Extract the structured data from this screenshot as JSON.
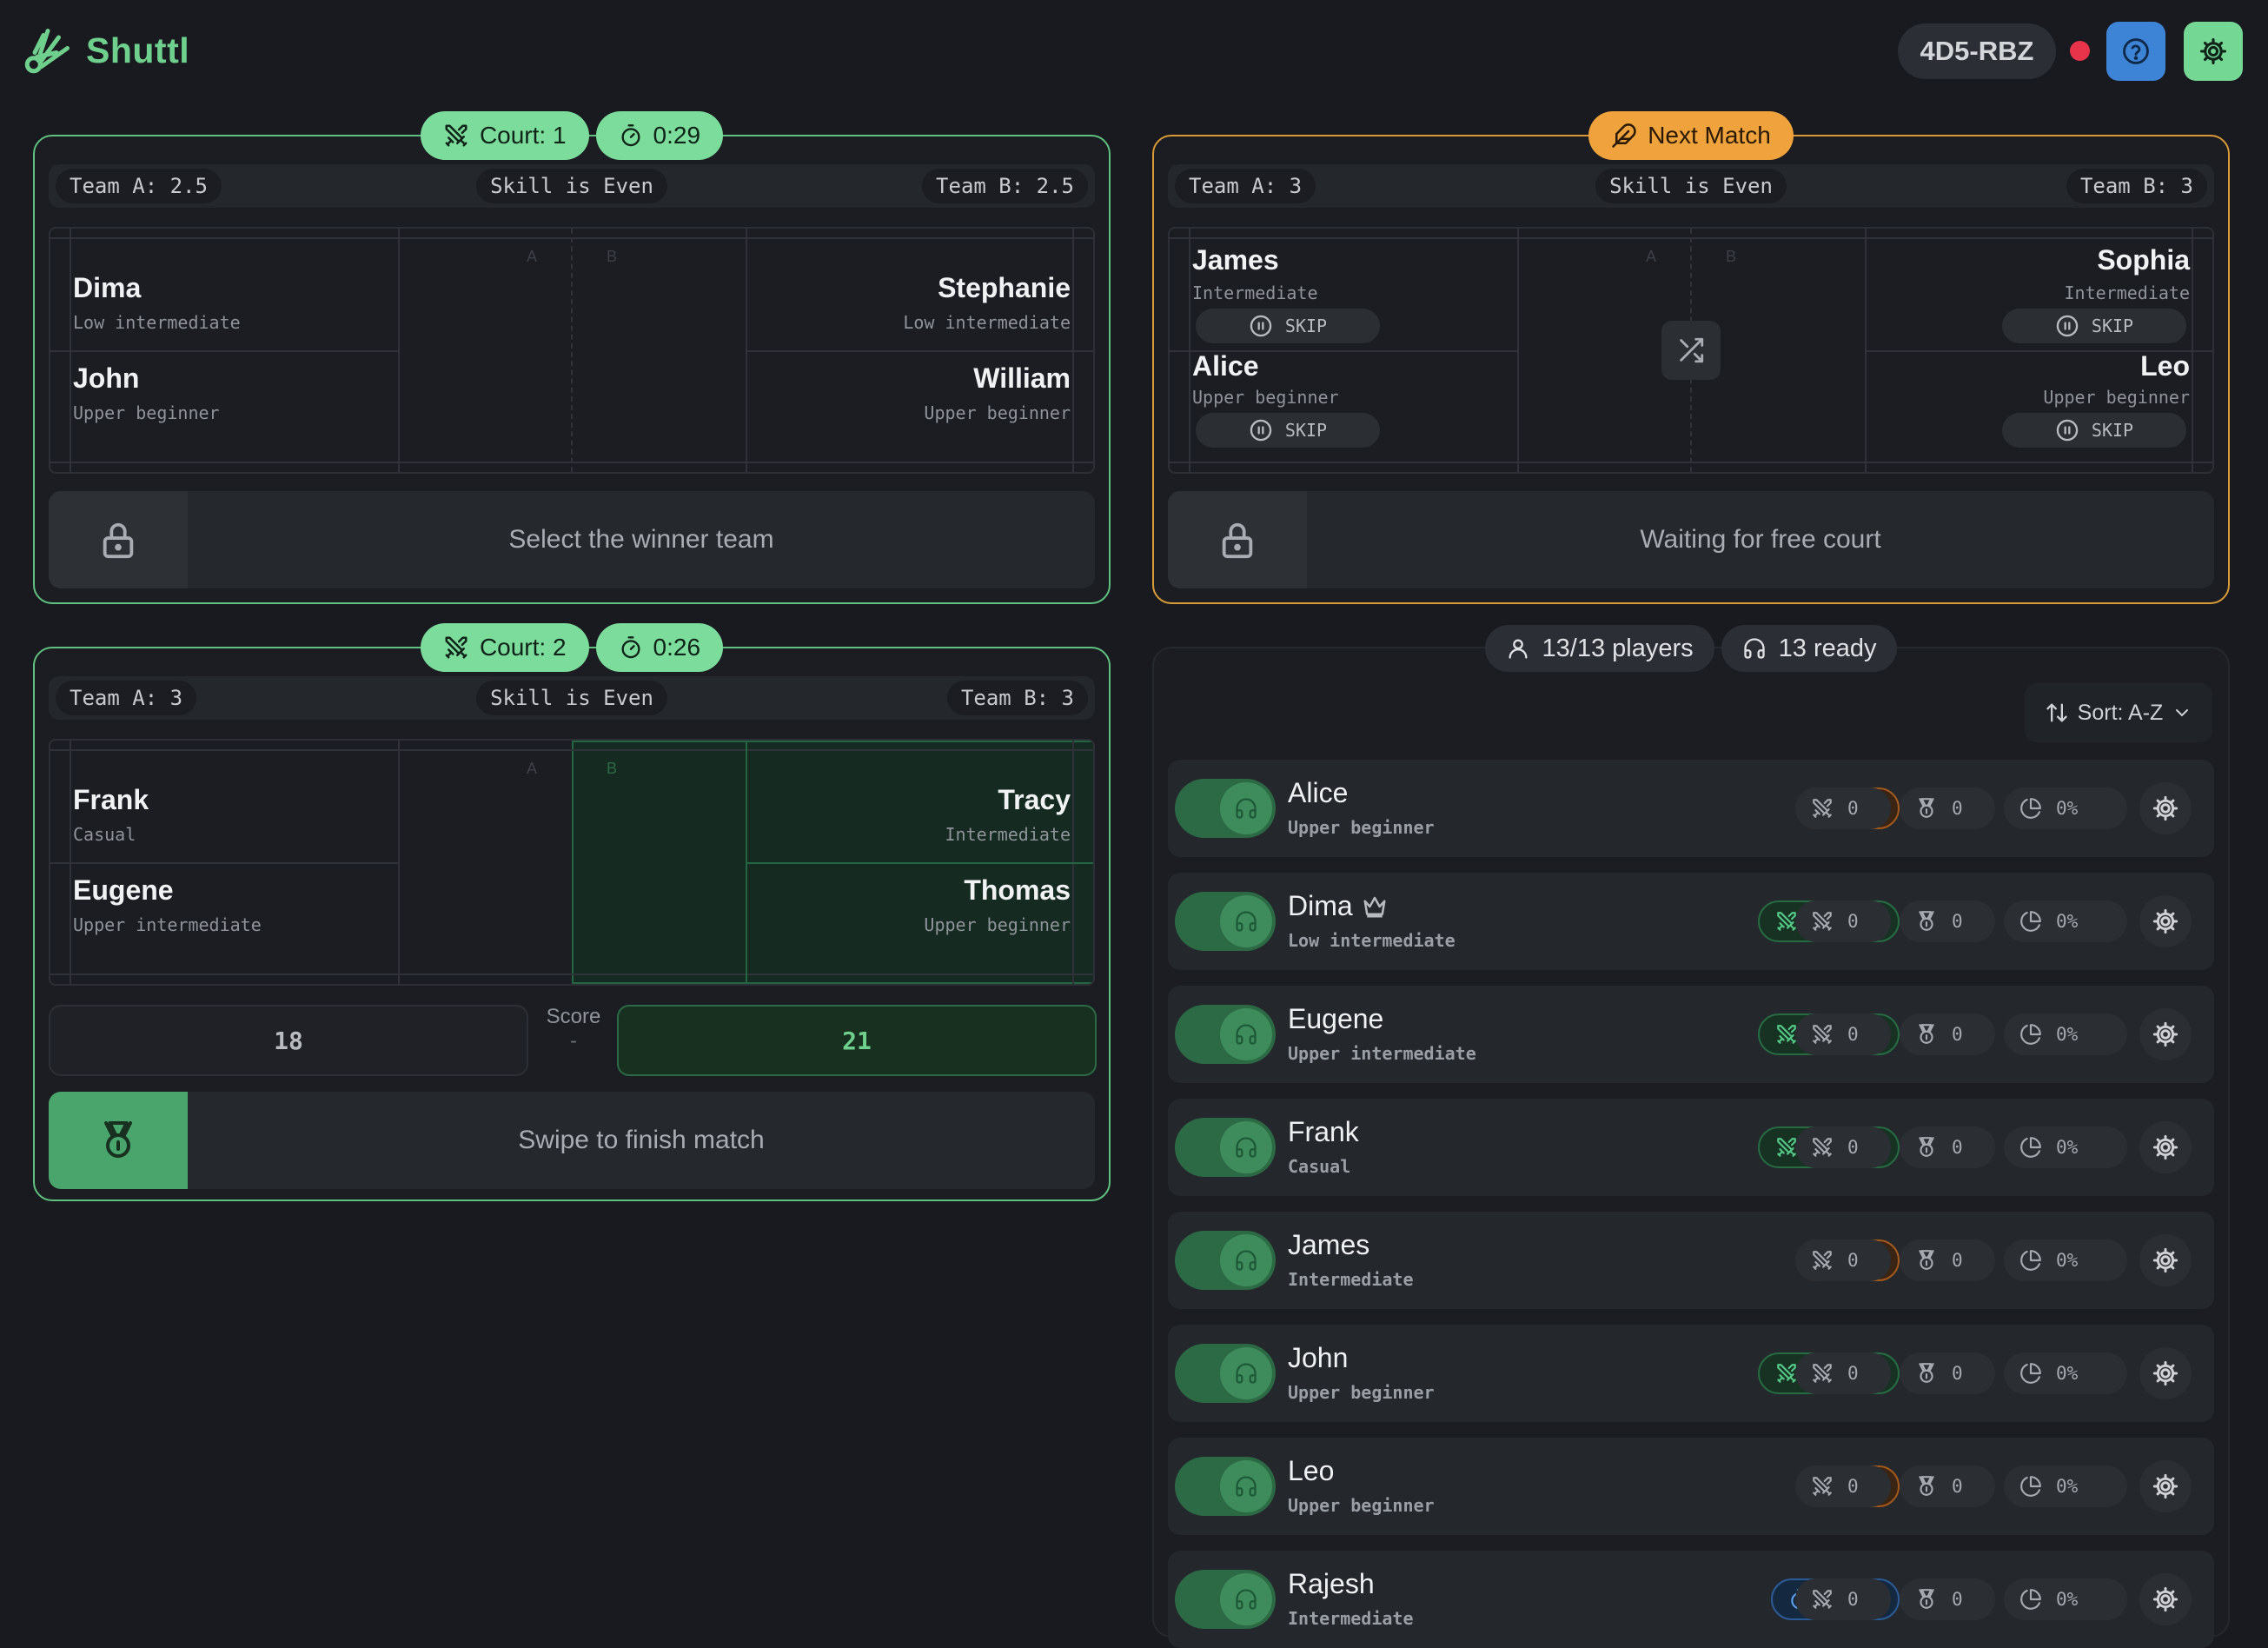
{
  "app": {
    "name": "Shuttl",
    "session_code": "4D5-RBZ"
  },
  "colors": {
    "accent": "#6fd08d",
    "next": "#f0a33d",
    "waiting": "#3d84d6",
    "record": "#e8344b"
  },
  "court1": {
    "court_label": "Court: 1",
    "timer": "0:29",
    "team_a": "Team A: 2.5",
    "skill": "Skill is Even",
    "team_b": "Team B: 2.5",
    "side_a": "A",
    "side_b": "B",
    "players_a": [
      {
        "name": "Dima",
        "level": "Low intermediate"
      },
      {
        "name": "John",
        "level": "Upper beginner"
      }
    ],
    "players_b": [
      {
        "name": "Stephanie",
        "level": "Low intermediate"
      },
      {
        "name": "William",
        "level": "Upper beginner"
      }
    ],
    "action": "Select the winner team"
  },
  "next_match": {
    "label": "Next Match",
    "team_a": "Team A: 3",
    "skill": "Skill is Even",
    "team_b": "Team B: 3",
    "side_a": "A",
    "side_b": "B",
    "players_a": [
      {
        "name": "James",
        "level": "Intermediate",
        "skip": "SKIP"
      },
      {
        "name": "Alice",
        "level": "Upper beginner",
        "skip": "SKIP"
      }
    ],
    "players_b": [
      {
        "name": "Sophia",
        "level": "Intermediate",
        "skip": "SKIP"
      },
      {
        "name": "Leo",
        "level": "Upper beginner",
        "skip": "SKIP"
      }
    ],
    "action": "Waiting for free court"
  },
  "court2": {
    "court_label": "Court: 2",
    "timer": "0:26",
    "team_a": "Team A: 3",
    "skill": "Skill is Even",
    "team_b": "Team B: 3",
    "side_a": "A",
    "side_b": "B",
    "players_a": [
      {
        "name": "Frank",
        "level": "Casual"
      },
      {
        "name": "Eugene",
        "level": "Upper intermediate"
      }
    ],
    "players_b": [
      {
        "name": "Tracy",
        "level": "Intermediate"
      },
      {
        "name": "Thomas",
        "level": "Upper beginner"
      }
    ],
    "score_a": "18",
    "score_label": "Score",
    "score_sep": "-",
    "score_b": "21",
    "action": "Swipe to finish match"
  },
  "players_panel": {
    "count": "13/13 players",
    "ready": "13 ready",
    "sort": "Sort: A-Z",
    "rows": [
      {
        "name": "Alice",
        "level": "Upper beginner",
        "status": "next",
        "stat_matches": "0",
        "stat_wins": "0",
        "stat_rate": "0%"
      },
      {
        "name": "Dima",
        "level": "Low intermediate",
        "status": "in match",
        "stat_matches": "0",
        "stat_wins": "0",
        "stat_rate": "0%",
        "crown": true
      },
      {
        "name": "Eugene",
        "level": "Upper intermediate",
        "status": "in match",
        "stat_matches": "0",
        "stat_wins": "0",
        "stat_rate": "0%"
      },
      {
        "name": "Frank",
        "level": "Casual",
        "status": "in match",
        "stat_matches": "0",
        "stat_wins": "0",
        "stat_rate": "0%"
      },
      {
        "name": "James",
        "level": "Intermediate",
        "status": "next",
        "stat_matches": "0",
        "stat_wins": "0",
        "stat_rate": "0%"
      },
      {
        "name": "John",
        "level": "Upper beginner",
        "status": "in match",
        "stat_matches": "0",
        "stat_wins": "0",
        "stat_rate": "0%"
      },
      {
        "name": "Leo",
        "level": "Upper beginner",
        "status": "next",
        "stat_matches": "0",
        "stat_wins": "0",
        "stat_rate": "0%"
      },
      {
        "name": "Rajesh",
        "level": "Intermediate",
        "status": "waiting",
        "stat_matches": "0",
        "stat_wins": "0",
        "stat_rate": "0%"
      }
    ]
  }
}
